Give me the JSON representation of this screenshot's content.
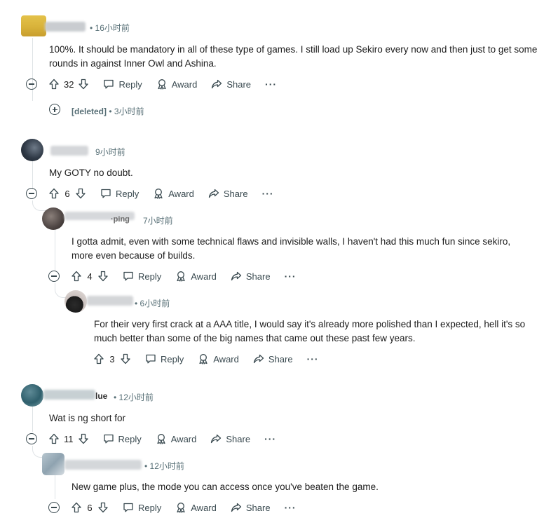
{
  "actions": {
    "reply": "Reply",
    "award": "Award",
    "share": "Share",
    "more": "···"
  },
  "comments": [
    {
      "author_visible": "",
      "time": "• 16小时前",
      "text": "100%. It should be mandatory in all of these type of games. I still load up Sekiro every now and then just to get some rounds in against Inner Owl and Ashina.",
      "votes": "32"
    },
    {
      "deleted_label": "[deleted]",
      "time": "• 3小时前"
    },
    {
      "author_visible": "",
      "time": "9小时前",
      "text": "My GOTY no doubt.",
      "votes": "6"
    },
    {
      "author_visible": "·ping",
      "time": "7小时前",
      "text": "I gotta admit, even with some technical flaws and invisible walls, I haven't had this much fun since sekiro, more even because of builds.",
      "votes": "4"
    },
    {
      "author_visible": "",
      "time": "• 6小时前",
      "text": "For their very first crack at a AAA title, I would say it's already more polished than I expected, hell it's so much better than some of the big names that came out these past few years.",
      "votes": "3"
    },
    {
      "author_visible": "lue",
      "time": "• 12小时前",
      "text": "Wat is ng short for",
      "votes": "11"
    },
    {
      "author_visible": "",
      "time": "• 12小时前",
      "text": "New game plus, the mode you can access once you've beaten the game.",
      "votes": "6"
    }
  ]
}
